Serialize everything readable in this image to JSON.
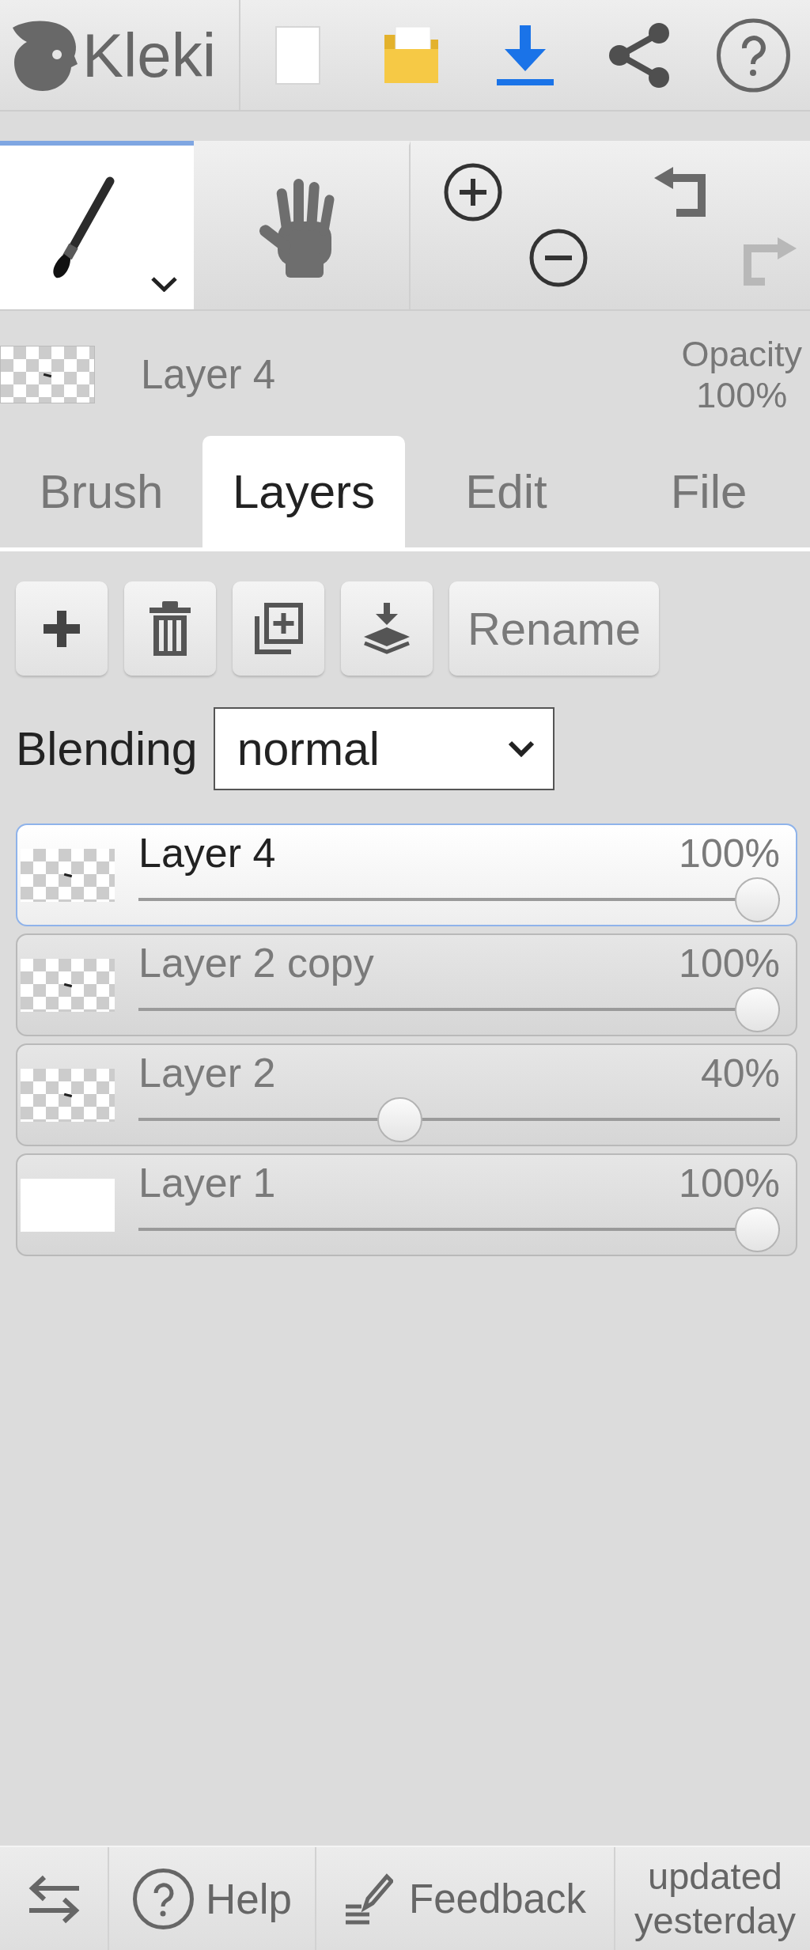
{
  "app_name": "Kleki",
  "tools": [
    {
      "kind": "brush",
      "selected": true
    },
    {
      "kind": "hand",
      "selected": false
    }
  ],
  "history": {
    "undo": {
      "disabled": false
    },
    "redo": {
      "disabled": true
    }
  },
  "current_layer": {
    "name": "Layer 4",
    "transparent": true,
    "opacity_label": "Opacity",
    "opacity": "100%"
  },
  "tabs": [
    {
      "label": "Brush",
      "selected": false
    },
    {
      "label": "Layers",
      "selected": true
    },
    {
      "label": "Edit",
      "selected": false
    },
    {
      "label": "File",
      "selected": false
    }
  ],
  "layer_buttons": [
    {
      "kind": "add"
    },
    {
      "kind": "delete"
    },
    {
      "kind": "duplicate"
    },
    {
      "kind": "merge"
    },
    {
      "kind": "text",
      "label": "Rename"
    }
  ],
  "blending": {
    "label": "Blending",
    "value": "normal"
  },
  "layers": [
    {
      "name": "Layer 4",
      "opacity": "100%",
      "level": 1,
      "selected": true,
      "transparent": true
    },
    {
      "name": "Layer 2 copy",
      "opacity": "100%",
      "level": 1,
      "selected": false,
      "transparent": true
    },
    {
      "name": "Layer 2",
      "opacity": "40%",
      "level": 0.4,
      "selected": false,
      "transparent": true
    },
    {
      "name": "Layer 1",
      "opacity": "100%",
      "level": 1,
      "selected": false,
      "transparent": false
    }
  ],
  "footer": {
    "help": "Help",
    "feedback": "Feedback",
    "updated": "updated yesterday"
  }
}
